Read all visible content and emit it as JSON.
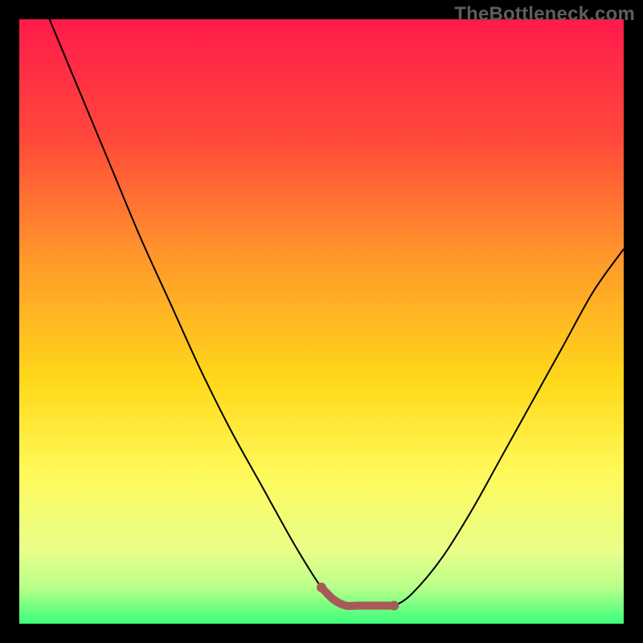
{
  "watermark": "TheBottleneck.com",
  "chart_data": {
    "type": "line",
    "title": "",
    "xlabel": "",
    "ylabel": "",
    "xlim": [
      0,
      100
    ],
    "ylim": [
      0,
      100
    ],
    "series": [
      {
        "name": "bottleneck-curve",
        "x": [
          5,
          10,
          15,
          20,
          25,
          30,
          35,
          40,
          45,
          48,
          50,
          52,
          54,
          56,
          58,
          60,
          62,
          65,
          70,
          75,
          80,
          85,
          90,
          95,
          100
        ],
        "y": [
          100,
          88,
          76,
          64,
          53,
          42,
          32,
          23,
          14,
          9,
          6,
          4,
          3,
          3,
          3,
          3,
          3,
          5,
          11,
          19,
          28,
          37,
          46,
          55,
          62
        ]
      }
    ],
    "highlight_region": {
      "x_start": 50,
      "x_end": 62,
      "color": "#a85a5a"
    },
    "gradient_stops": [
      {
        "pct": 0,
        "color": "#ff1a4b"
      },
      {
        "pct": 20,
        "color": "#ff4a3a"
      },
      {
        "pct": 40,
        "color": "#ff9a2a"
      },
      {
        "pct": 60,
        "color": "#ffd91a"
      },
      {
        "pct": 75,
        "color": "#fff95a"
      },
      {
        "pct": 88,
        "color": "#e8ff8a"
      },
      {
        "pct": 94,
        "color": "#b8ff8a"
      },
      {
        "pct": 100,
        "color": "#3aff7a"
      }
    ]
  }
}
